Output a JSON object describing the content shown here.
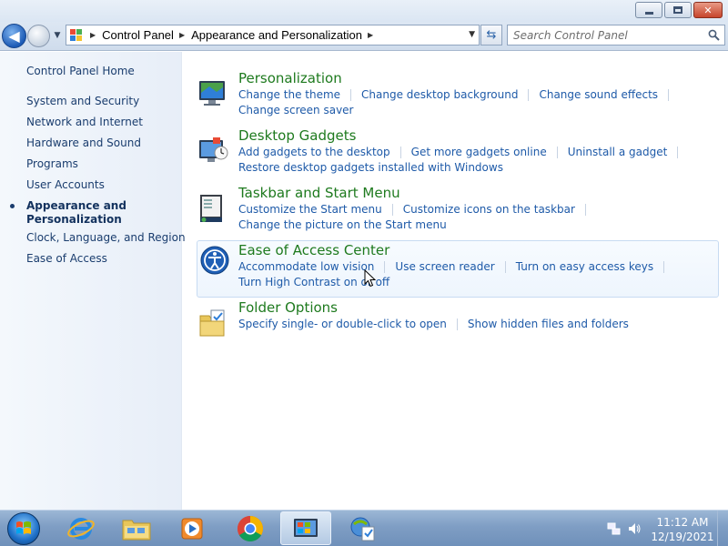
{
  "window": {
    "min_glyph": "",
    "max_glyph": "",
    "close_glyph": "✕"
  },
  "nav": {
    "back_glyph": "◀",
    "recent_glyph": "▼",
    "breadcrumb": [
      "Control Panel",
      "Appearance and Personalization"
    ],
    "crumb_sep": "▶",
    "dropdown_glyph": "▼",
    "refresh_glyph": "⇆",
    "search_placeholder": "Search Control Panel"
  },
  "sidebar": {
    "home": "Control Panel Home",
    "items": [
      "System and Security",
      "Network and Internet",
      "Hardware and Sound",
      "Programs",
      "User Accounts",
      "Appearance and",
      "Personalization",
      "Clock, Language, and Region",
      "Ease of Access"
    ]
  },
  "sections": [
    {
      "title": "Personalization",
      "icon": "monitor-desktop-icon",
      "rows": [
        [
          "Change the theme",
          "Change desktop background",
          "Change sound effects"
        ],
        [
          "Change screen saver"
        ]
      ]
    },
    {
      "title": "Desktop Gadgets",
      "icon": "gadgets-icon",
      "rows": [
        [
          "Add gadgets to the desktop",
          "Get more gadgets online",
          "Uninstall a gadget"
        ],
        [
          "Restore desktop gadgets installed with Windows"
        ]
      ]
    },
    {
      "title": "Taskbar and Start Menu",
      "icon": "taskbar-icon",
      "rows": [
        [
          "Customize the Start menu",
          "Customize icons on the taskbar"
        ],
        [
          "Change the picture on the Start menu"
        ]
      ]
    },
    {
      "title": "Ease of Access Center",
      "icon": "ease-of-access-icon",
      "rows": [
        [
          "Accommodate low vision",
          "Use screen reader",
          "Turn on easy access keys"
        ],
        [
          "Turn High Contrast on or off"
        ]
      ]
    },
    {
      "title": "Folder Options",
      "icon": "folder-options-icon",
      "rows": [
        [
          "Specify single- or double-click to open",
          "Show hidden files and folders"
        ]
      ]
    }
  ],
  "taskbar": {
    "items": [
      "start-orb",
      "internet-explorer-icon",
      "windows-explorer-icon",
      "media-player-icon",
      "chrome-icon",
      "control-panel-icon",
      "action-center-icon"
    ],
    "time": "11:12 AM",
    "date": "12/19/2021"
  },
  "colors": {
    "section_title": "#1e7a1e",
    "link": "#1e5aa8",
    "sidebar_link": "#1a3d6e"
  }
}
